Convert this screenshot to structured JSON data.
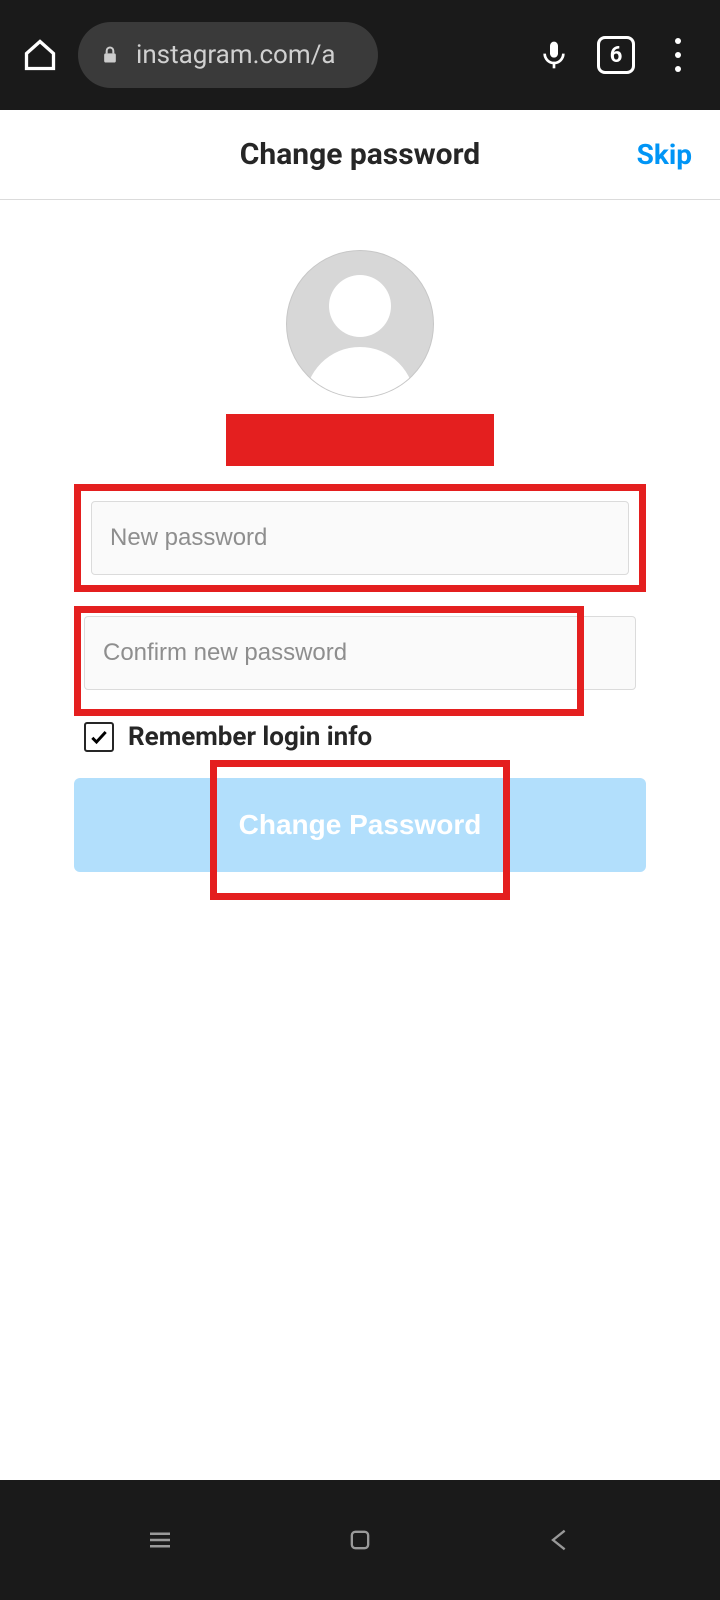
{
  "browser": {
    "url": "instagram.com/a",
    "tab_count": "6"
  },
  "header": {
    "title": "Change password",
    "skip": "Skip"
  },
  "form": {
    "new_password_placeholder": "New password",
    "confirm_password_placeholder": "Confirm new password",
    "remember_label": "Remember login info",
    "remember_checked": true,
    "submit_label": "Change Password"
  }
}
